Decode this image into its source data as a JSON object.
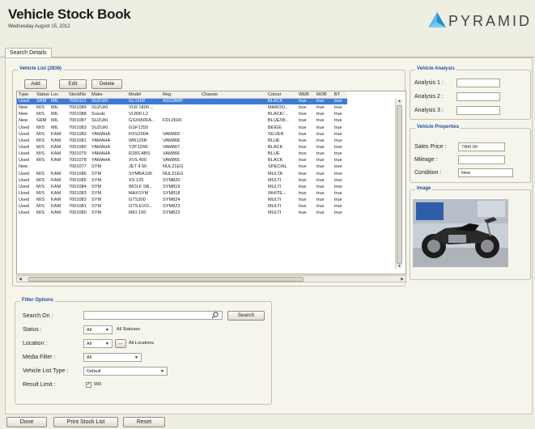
{
  "header": {
    "title": "Vehicle Stock Book",
    "date": "Wednesday August 15, 2012",
    "brand": "PYRAMID"
  },
  "tabs": [
    {
      "label": "Search Details"
    }
  ],
  "vehicle_list": {
    "legend": "Vehicle List (2836)",
    "buttons": {
      "add": "Add",
      "edit": "Edit",
      "delete": "Delete"
    },
    "columns": [
      "Type",
      "Status",
      "Loc",
      "StockNo",
      "Make",
      "Model",
      "Reg",
      "Chassis",
      "Colour",
      "WEB",
      "MOB",
      "BT"
    ],
    "rows": [
      [
        "Used",
        "SRM",
        "MIL",
        "7000110",
        "SUZUKI",
        "GL1500",
        "ASG260P",
        "",
        "BLACK",
        "true",
        "true",
        "true"
      ],
      [
        "New",
        "M/S",
        "MIL",
        "7001089",
        "SUZUKI",
        "VLR 1800 ...",
        "",
        "",
        "MAROO...",
        "true",
        "true",
        "true"
      ],
      [
        "New",
        "M/S",
        "MIL",
        "7001088",
        "Suzuki",
        "VL800 L2",
        "",
        "",
        "BLACK/...",
        "true",
        "true",
        "true"
      ],
      [
        "New",
        "SRM",
        "MIL",
        "7001087",
        "SUZUKI",
        "GSX650FA...",
        "FDL260X",
        "",
        "BLUE/W...",
        "true",
        "true",
        "true"
      ],
      [
        "Used",
        "M/S",
        "MIL",
        "7001083",
        "SUZUKI",
        "GSF1250",
        "",
        "",
        "BEIGE",
        "true",
        "true",
        "true"
      ],
      [
        "Used",
        "M/S",
        "KAM",
        "7001082",
        "YAMAHA",
        "RXS200A",
        "VAM869",
        "",
        "SILVER",
        "true",
        "true",
        "true"
      ],
      [
        "Used",
        "M/S",
        "KAM",
        "7001081",
        "YAMAHA",
        "WR125R",
        "VAM868",
        "",
        "BLUE",
        "true",
        "true",
        "true"
      ],
      [
        "Used",
        "M/S",
        "KAM",
        "7001080",
        "YAMAHA",
        "YZF125R",
        "VAM867",
        "",
        "BLACK",
        "true",
        "true",
        "true"
      ],
      [
        "Used",
        "M/S",
        "KAM",
        "7001079",
        "YAMAHA",
        "R28S ABS",
        "VAM866",
        "",
        "BLUE",
        "true",
        "true",
        "true"
      ],
      [
        "Used",
        "M/S",
        "KAM",
        "7001078",
        "YAMAHA",
        "XVS 400",
        "VAM865",
        "",
        "BLACK",
        "true",
        "true",
        "true"
      ],
      [
        "New",
        "",
        "",
        "7001077",
        "SYM",
        "JET 4 50",
        "NUL21EG",
        "",
        "SPECIAL",
        "true",
        "true",
        "true"
      ],
      [
        "Used",
        "M/S",
        "KAM",
        "7001086",
        "SYM",
        "SYMBA100",
        "NUL21EG",
        "",
        "MULTA",
        "true",
        "true",
        "true"
      ],
      [
        "Used",
        "M/S",
        "KAM",
        "7001085",
        "SYM",
        "XS 125",
        "SYM820",
        "",
        "MULTI",
        "true",
        "true",
        "true"
      ],
      [
        "Used",
        "M/S",
        "KAM",
        "7001084",
        "SYM",
        "WOLF SB...",
        "SYM819",
        "",
        "MULTI",
        "true",
        "true",
        "true"
      ],
      [
        "Used",
        "M/S",
        "KAM",
        "7001083",
        "SYM",
        "MAXSYM",
        "SYM818",
        "",
        "WHITE...",
        "true",
        "true",
        "true"
      ],
      [
        "Used",
        "M/S",
        "KAM",
        "7001082",
        "SYM",
        "GTS300",
        "SYM824",
        "",
        "MULTI",
        "true",
        "true",
        "true"
      ],
      [
        "Used",
        "M/S",
        "KAM",
        "7001081",
        "SYM",
        "GTS EVO...",
        "SYM823",
        "",
        "MULTI",
        "true",
        "true",
        "true"
      ],
      [
        "Used",
        "M/S",
        "KAM",
        "7001080",
        "SYM",
        "MIO 100",
        "SYM822",
        "",
        "MULTI",
        "true",
        "true",
        "true"
      ]
    ]
  },
  "vehicle_analysis": {
    "legend": "Vehicle Analysis",
    "fields": [
      {
        "label": "Analysis 1 :",
        "value": ""
      },
      {
        "label": "Analysis 2 :",
        "value": ""
      },
      {
        "label": "Analysis 3 :",
        "value": ""
      }
    ]
  },
  "vehicle_properties": {
    "legend": "Vehicle Properties",
    "sales_price_label": "Sales Price :",
    "sales_price_value": "7400.00",
    "mileage_label": "Mileage :",
    "mileage_value": "",
    "condition_label": "Condition :",
    "condition_value": "New"
  },
  "image_panel": {
    "legend": "Image"
  },
  "filter": {
    "legend": "Filter Options",
    "search_label": "Search On :",
    "search_value": "",
    "search_button": "Search",
    "status_label": "Status :",
    "status_value": "All",
    "status_text": "All Statuses",
    "location_label": "Location :",
    "location_value": "All",
    "location_text": "All Locations",
    "media_label": "Media Filter :",
    "media_value": "All",
    "list_type_label": "Vehicle List Type :",
    "list_type_value": "Default",
    "result_limit_label": "Result Limit :",
    "result_limit_value": "999",
    "result_limit_checked": true
  },
  "footer": {
    "done": "Done",
    "print": "Print Stock List",
    "reset": "Reset"
  },
  "colors": {
    "selection": "#3e7ad6",
    "legend": "#1f4f9a",
    "brand": "#1f9ad6"
  }
}
